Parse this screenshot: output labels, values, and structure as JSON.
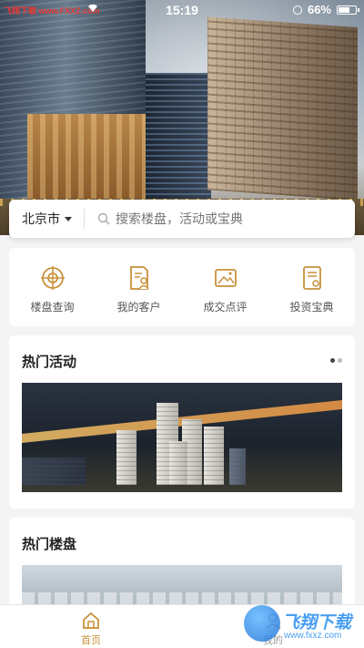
{
  "status_bar": {
    "carrier": "飞翔下载 www.FXXZ.com",
    "time": "15:19",
    "battery": "66%"
  },
  "search": {
    "city": "北京市",
    "placeholder": "搜索楼盘，活动或宝典"
  },
  "menu": {
    "items": [
      {
        "label": "楼盘查询",
        "icon": "target-icon"
      },
      {
        "label": "我的客户",
        "icon": "customer-doc-icon"
      },
      {
        "label": "成交点评",
        "icon": "review-image-icon"
      },
      {
        "label": "投资宝典",
        "icon": "guide-book-icon"
      }
    ]
  },
  "sections": {
    "activities": {
      "title": "热门活动"
    },
    "properties": {
      "title": "热门楼盘"
    }
  },
  "tabbar": {
    "tabs": [
      {
        "label": "首页",
        "active": true
      },
      {
        "label": "我的",
        "active": false
      }
    ]
  },
  "watermark": {
    "text": "飞翔下载",
    "url": "www.fxxz.com"
  },
  "colors": {
    "accent": "#c8913a",
    "background": "#f4f4f4"
  }
}
